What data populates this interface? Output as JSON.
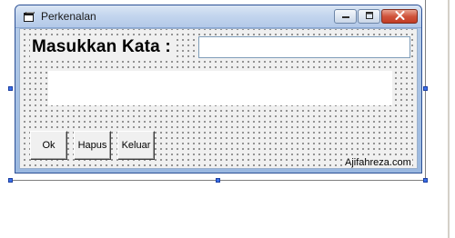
{
  "window": {
    "title": "Perkenalan"
  },
  "form": {
    "prompt_label": "Masukkan Kata :",
    "input_value": "",
    "output_text": "",
    "buttons": {
      "ok": "Ok",
      "hapus": "Hapus",
      "keluar": "Keluar"
    },
    "credit": "Ajifahreza.com"
  },
  "icons": {
    "window": "form-window-icon",
    "minimize": "minimize-icon",
    "maximize": "maximize-icon",
    "close": "close-icon"
  },
  "colors": {
    "titlebar": "#c4d6ee",
    "close_button": "#d0543c",
    "form_background": "#f0f0f0",
    "selection_grip": "#3a6ee8"
  }
}
